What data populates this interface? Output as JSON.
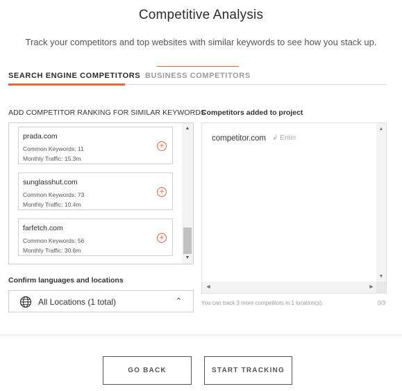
{
  "header": {
    "title": "Competitive Analysis",
    "subtitle": "Track your competitors and top websites with similar keywords to see how you stack up."
  },
  "tabs": [
    {
      "label": "SEARCH ENGINE COMPETITORS",
      "active": true
    },
    {
      "label": "BUSINESS COMPETITORS",
      "active": false
    }
  ],
  "suggestions": {
    "heading": "ADD COMPETITOR RANKING FOR SIMILAR KEYWORDS",
    "keywords_label": "Common Keywords:",
    "traffic_label": "Monthly Traffic:",
    "items": [
      {
        "domain": "prada.com",
        "common_keywords": "11",
        "monthly_traffic": "15.3m"
      },
      {
        "domain": "sunglasshut.com",
        "common_keywords": "73",
        "monthly_traffic": "10.4m"
      },
      {
        "domain": "farfetch.com",
        "common_keywords": "56",
        "monthly_traffic": "30.6m"
      }
    ]
  },
  "locations": {
    "heading": "Confirm languages and locations",
    "selected": "All Locations (1 total)"
  },
  "added": {
    "heading": "Competitors added to project",
    "input_value": "competitor.com",
    "enter_hint": "↲ Enter",
    "note": "You can track 3 more competitors in 1 location(s).",
    "count": "0/3"
  },
  "footer": {
    "back_label": "GO BACK",
    "track_label": "START TRACKING"
  },
  "colors": {
    "accent": "#e8643c",
    "border": "#cfcfcf"
  }
}
